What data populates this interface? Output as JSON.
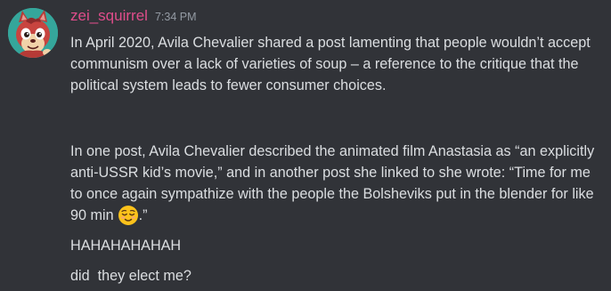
{
  "author": {
    "username": "zei_squirrel",
    "timestamp": "7:34 PM",
    "name_color": "#e04d8b"
  },
  "messages": [
    {
      "text": "In April 2020, Avila Chevalier shared a post lamenting that people wouldn’t accept communism over a lack of varieties of soup – a reference to the critique that the political system leads to fewer consumer choices."
    },
    {
      "text": "In one post, Avila Chevalier described the animated film Anastasia as “an explicitly anti-USSR kid’s movie,” and in another post she linked to she wrote: “Time for me to once again sympathize with the people the Bolsheviks put in the blender for like 90 min",
      "emoji": "relieved-face-emoji",
      "text_after": ".”"
    },
    {
      "text": "HAHAHAHAHAH"
    },
    {
      "text": "did  they elect me?"
    }
  ],
  "colors": {
    "background": "#313338",
    "text": "#dbdee1",
    "timestamp": "#949ba4"
  },
  "icons": {
    "avatar": "red-squirrel-avatar"
  }
}
